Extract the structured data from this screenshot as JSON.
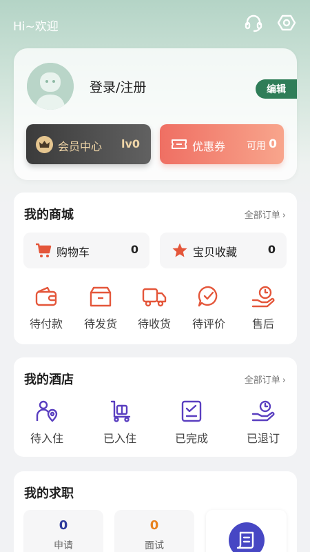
{
  "header": {
    "greeting": "Hi~欢迎",
    "icons": [
      "headset-icon",
      "settings-icon"
    ]
  },
  "profile": {
    "login_label": "登录/注册",
    "edit_label": "编辑",
    "member": {
      "label": "会员中心",
      "level": "lv0"
    },
    "coupon": {
      "label": "优惠券",
      "available_label": "可用",
      "count": "0"
    }
  },
  "mall": {
    "title": "我的商城",
    "all_orders": "全部订单",
    "cart": {
      "label": "购物车",
      "count": "0"
    },
    "favorites": {
      "label": "宝贝收藏",
      "count": "0"
    },
    "statuses": [
      {
        "label": "待付款",
        "icon": "wallet-icon"
      },
      {
        "label": "待发货",
        "icon": "package-icon"
      },
      {
        "label": "待收货",
        "icon": "truck-icon"
      },
      {
        "label": "待评价",
        "icon": "comment-icon"
      },
      {
        "label": "售后",
        "icon": "after-sale-icon"
      }
    ]
  },
  "hotel": {
    "title": "我的酒店",
    "all_orders": "全部订单",
    "statuses": [
      {
        "label": "待入住",
        "icon": "person-location-icon"
      },
      {
        "label": "已入住",
        "icon": "luggage-icon"
      },
      {
        "label": "已完成",
        "icon": "checklist-icon"
      },
      {
        "label": "已退订",
        "icon": "refund-icon"
      }
    ]
  },
  "jobs": {
    "title": "我的求职",
    "stats": [
      {
        "label": "申请",
        "value": "0",
        "color": "#2e3a9c"
      },
      {
        "label": "面试",
        "value": "0",
        "color": "#e8821f"
      }
    ],
    "resume_icon": "resume-icon"
  },
  "colors": {
    "accent_green": "#2f7d58",
    "mall_icon": "#e4563a",
    "hotel_icon": "#5a3fc0",
    "coupon_start": "#ef6f63"
  }
}
